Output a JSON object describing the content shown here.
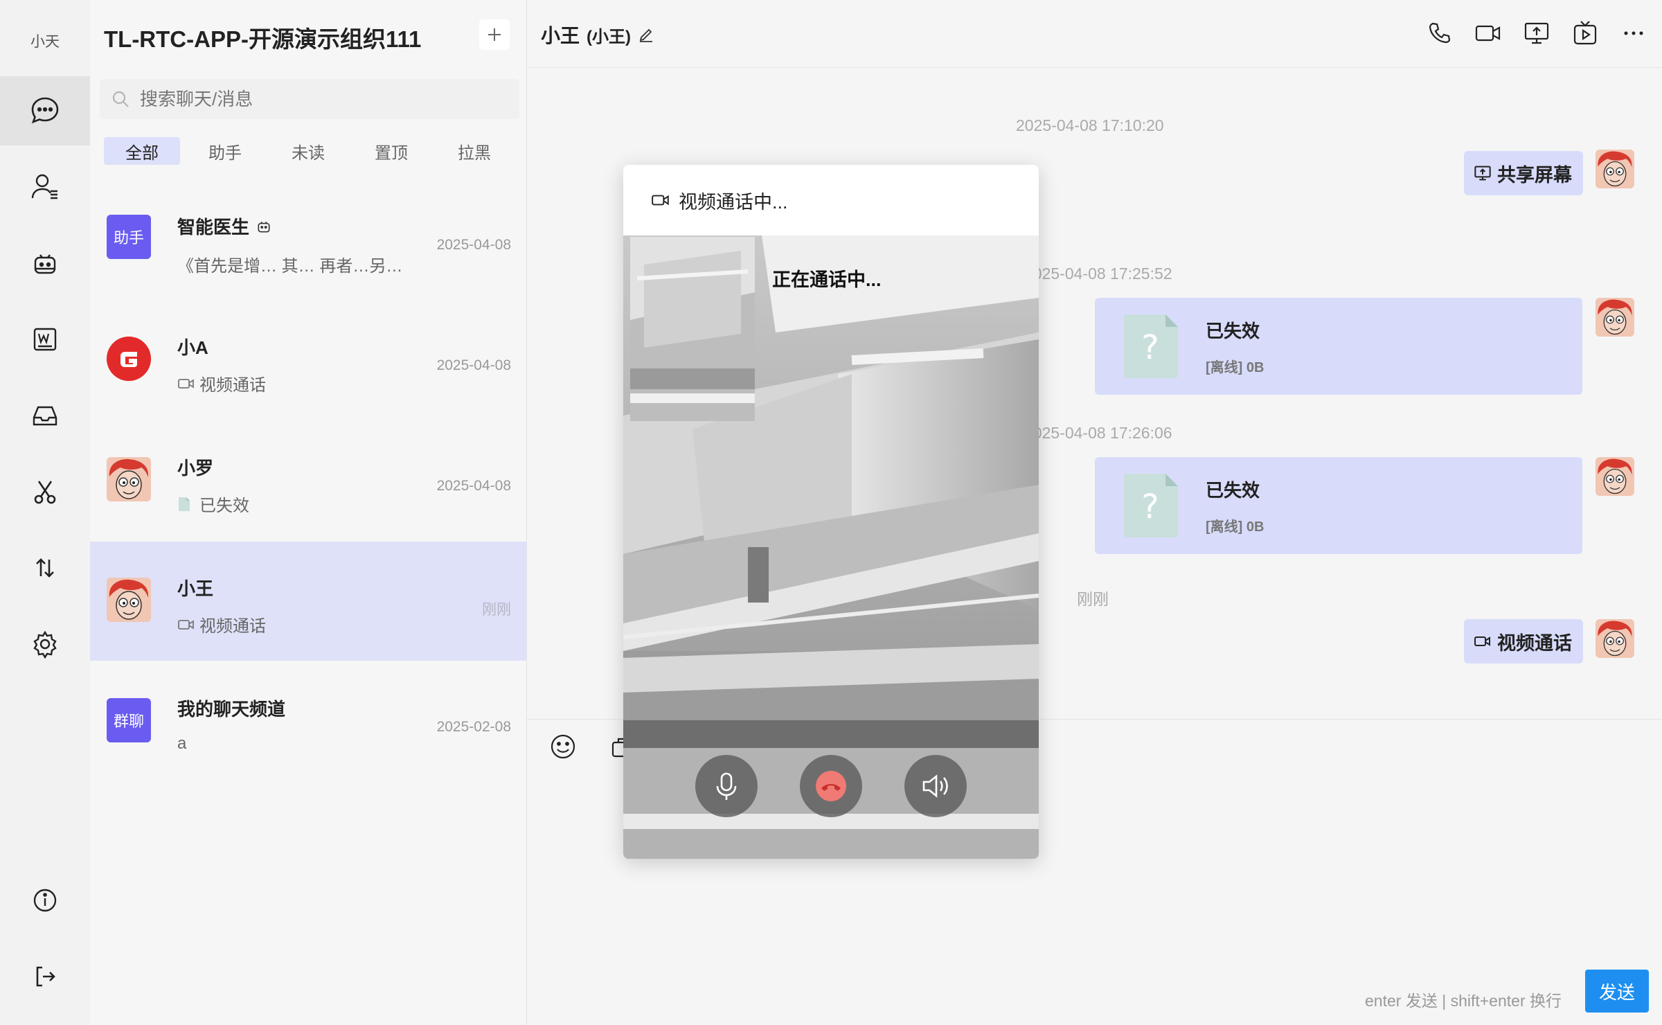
{
  "app": {
    "user_name": "小天",
    "org_name": "TL-RTC-APP-开源演示组织111",
    "search_placeholder": "搜索聊天/消息",
    "accent_color": "#1e8ff0",
    "selection_color": "#dfe1f8"
  },
  "rail": {
    "items": [
      {
        "icon": "chat-bubble-icon",
        "active": true
      },
      {
        "icon": "contacts-icon"
      },
      {
        "icon": "robot-icon"
      },
      {
        "icon": "word-doc-icon"
      },
      {
        "icon": "inbox-icon"
      },
      {
        "icon": "scissors-icon"
      },
      {
        "icon": "transfer-arrows-icon"
      },
      {
        "icon": "settings-gear-icon"
      },
      {
        "icon": "info-icon"
      },
      {
        "icon": "logout-icon"
      }
    ]
  },
  "filters": [
    "全部",
    "助手",
    "未读",
    "置顶",
    "拉黑"
  ],
  "conversations": [
    {
      "name": "智能医生",
      "tag_icon": "robot-icon",
      "avatar_text": "助手",
      "avatar_color": "#6a5cf0",
      "preview": "《首先是增… 其… 再者…另…",
      "time": "2025-04-08"
    },
    {
      "name": "小A",
      "avatar_text": "G",
      "avatar_color": "#e32a2a",
      "preview": "视频通话",
      "preview_icon": "video-icon",
      "time": "2025-04-08"
    },
    {
      "name": "小罗",
      "avatar_text": "",
      "preview": "已失效",
      "preview_icon": "file-icon",
      "time": "2025-04-08"
    },
    {
      "name": "小王",
      "avatar_text": "",
      "preview": "视频通话",
      "preview_icon": "video-icon",
      "time": "刚刚",
      "active": true
    },
    {
      "name": "我的聊天频道",
      "avatar_text": "群聊",
      "avatar_color": "#6a5cf0",
      "preview": "a",
      "time": "2025-02-08"
    }
  ],
  "chat": {
    "title": "小王",
    "subtitle": "(小王)",
    "header_icons": [
      "phone-icon",
      "video-camera-icon",
      "screen-share-icon",
      "live-stream-icon",
      "more-icon"
    ],
    "messages": [
      {
        "timestamp": "2025-04-08 17:10:20",
        "type": "action",
        "icon": "screen-share-icon",
        "text": "共享屏幕"
      },
      {
        "timestamp": "2025-04-08 17:25:52",
        "type": "file",
        "file_name": "已失效",
        "file_meta": "[离线] 0B"
      },
      {
        "timestamp": "2025-04-08 17:26:06",
        "type": "file",
        "file_name": "已失效",
        "file_meta": "[离线] 0B"
      },
      {
        "timestamp": "刚刚",
        "type": "action",
        "icon": "video-icon",
        "text": "视频通话"
      }
    ],
    "hint": "enter 发送 | shift+enter 换行",
    "send_label": "发送"
  },
  "call": {
    "title": "视频通话中...",
    "status": "正在通话中...",
    "controls": [
      "microphone-icon",
      "hang-up-icon",
      "speaker-icon"
    ]
  }
}
